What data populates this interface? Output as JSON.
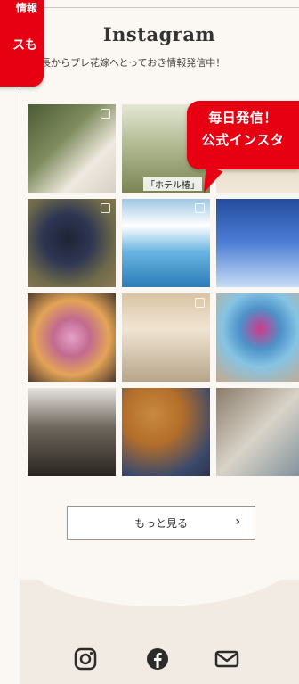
{
  "badges": {
    "left": {
      "line1": "情報",
      "line2": "スも"
    },
    "right": {
      "line1": "毎日発信！",
      "line2": "公式インスタ"
    }
  },
  "header": {
    "title": "Instagram",
    "subtitle": "編集長からプレ花嫁へとっておき情報発信中！"
  },
  "feed": {
    "posts": [
      {
        "alt": "woman with bouquet",
        "color": "#7e8c5e"
      },
      {
        "alt": "event poster",
        "color": "#b8c09a",
        "overlay": "「ホテル椿」"
      },
      {
        "alt": "poster beige",
        "color": "#d9c7a6"
      },
      {
        "alt": "dark teddy bear",
        "color": "#2d3552"
      },
      {
        "alt": "poolside building",
        "color": "#6ab4e1"
      },
      {
        "alt": "blue drink",
        "color": "#4d7fd6"
      },
      {
        "alt": "flower bouquet",
        "color": "#c26a8f"
      },
      {
        "alt": "group photo",
        "color": "#b7a58a"
      },
      {
        "alt": "blue cocktail",
        "color": "#86c4e3"
      },
      {
        "alt": "hotel entrance",
        "color": "#6e665c"
      },
      {
        "alt": "pies",
        "color": "#b46e2a"
      },
      {
        "alt": "magazines",
        "color": "#d9d3c8"
      }
    ],
    "more_label": "もっと見る"
  },
  "social": {
    "icons": [
      "instagram-icon",
      "facebook-icon",
      "mail-icon"
    ]
  }
}
